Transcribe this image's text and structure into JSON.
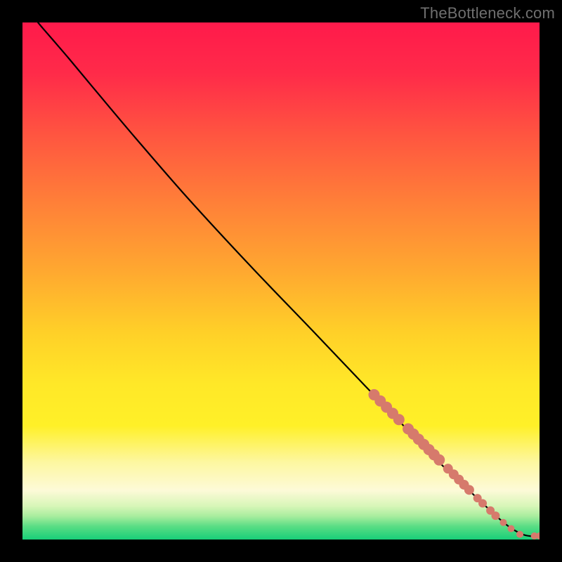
{
  "watermark": "TheBottleneck.com",
  "chart_data": {
    "type": "line",
    "title": "",
    "xlabel": "",
    "ylabel": "",
    "xlim": [
      0,
      100
    ],
    "ylim": [
      0,
      100
    ],
    "background_gradient": {
      "stops": [
        {
          "offset": 0.0,
          "color": "#ff1a4b"
        },
        {
          "offset": 0.1,
          "color": "#ff2b49"
        },
        {
          "offset": 0.22,
          "color": "#ff5640"
        },
        {
          "offset": 0.35,
          "color": "#ff8038"
        },
        {
          "offset": 0.48,
          "color": "#ffa830"
        },
        {
          "offset": 0.6,
          "color": "#ffd028"
        },
        {
          "offset": 0.7,
          "color": "#ffe828"
        },
        {
          "offset": 0.78,
          "color": "#fff028"
        },
        {
          "offset": 0.85,
          "color": "#fdf7a0"
        },
        {
          "offset": 0.905,
          "color": "#fdfad8"
        },
        {
          "offset": 0.935,
          "color": "#d8f6b8"
        },
        {
          "offset": 0.955,
          "color": "#a8ed9e"
        },
        {
          "offset": 0.975,
          "color": "#58dd84"
        },
        {
          "offset": 1.0,
          "color": "#18cf79"
        }
      ]
    },
    "curve": [
      {
        "x": 3.0,
        "y": 100.0
      },
      {
        "x": 4.0,
        "y": 98.8
      },
      {
        "x": 6.0,
        "y": 96.5
      },
      {
        "x": 9.0,
        "y": 93.0
      },
      {
        "x": 14.0,
        "y": 87.0
      },
      {
        "x": 22.0,
        "y": 77.5
      },
      {
        "x": 32.0,
        "y": 66.0
      },
      {
        "x": 44.0,
        "y": 53.0
      },
      {
        "x": 56.0,
        "y": 40.5
      },
      {
        "x": 66.0,
        "y": 30.0
      },
      {
        "x": 74.0,
        "y": 21.7
      },
      {
        "x": 80.0,
        "y": 15.5
      },
      {
        "x": 85.0,
        "y": 10.8
      },
      {
        "x": 89.0,
        "y": 7.0
      },
      {
        "x": 92.0,
        "y": 4.2
      },
      {
        "x": 94.5,
        "y": 2.2
      },
      {
        "x": 97.0,
        "y": 0.9
      },
      {
        "x": 99.0,
        "y": 0.6
      },
      {
        "x": 100.0,
        "y": 0.6
      }
    ],
    "series": [
      {
        "name": "highlighted-points",
        "color": "#d67a6c",
        "points": [
          {
            "x": 68.0,
            "y": 28.0,
            "r": 8
          },
          {
            "x": 69.2,
            "y": 26.8,
            "r": 8
          },
          {
            "x": 70.4,
            "y": 25.6,
            "r": 8
          },
          {
            "x": 71.6,
            "y": 24.4,
            "r": 8
          },
          {
            "x": 72.8,
            "y": 23.2,
            "r": 8
          },
          {
            "x": 74.6,
            "y": 21.4,
            "r": 8
          },
          {
            "x": 75.6,
            "y": 20.4,
            "r": 8
          },
          {
            "x": 76.6,
            "y": 19.4,
            "r": 8
          },
          {
            "x": 77.6,
            "y": 18.4,
            "r": 8
          },
          {
            "x": 78.6,
            "y": 17.4,
            "r": 8
          },
          {
            "x": 79.6,
            "y": 16.4,
            "r": 8
          },
          {
            "x": 80.6,
            "y": 15.4,
            "r": 8
          },
          {
            "x": 82.3,
            "y": 13.7,
            "r": 7
          },
          {
            "x": 83.4,
            "y": 12.6,
            "r": 7
          },
          {
            "x": 84.4,
            "y": 11.6,
            "r": 7
          },
          {
            "x": 85.4,
            "y": 10.6,
            "r": 7
          },
          {
            "x": 86.4,
            "y": 9.6,
            "r": 7
          },
          {
            "x": 88.0,
            "y": 8.0,
            "r": 6
          },
          {
            "x": 89.0,
            "y": 7.0,
            "r": 6
          },
          {
            "x": 90.5,
            "y": 5.6,
            "r": 6
          },
          {
            "x": 91.5,
            "y": 4.6,
            "r": 6
          },
          {
            "x": 93.0,
            "y": 3.3,
            "r": 5
          },
          {
            "x": 94.5,
            "y": 2.1,
            "r": 5
          },
          {
            "x": 96.2,
            "y": 1.0,
            "r": 5
          },
          {
            "x": 99.0,
            "y": 0.7,
            "r": 5
          },
          {
            "x": 100.0,
            "y": 0.7,
            "r": 5
          }
        ]
      }
    ]
  }
}
